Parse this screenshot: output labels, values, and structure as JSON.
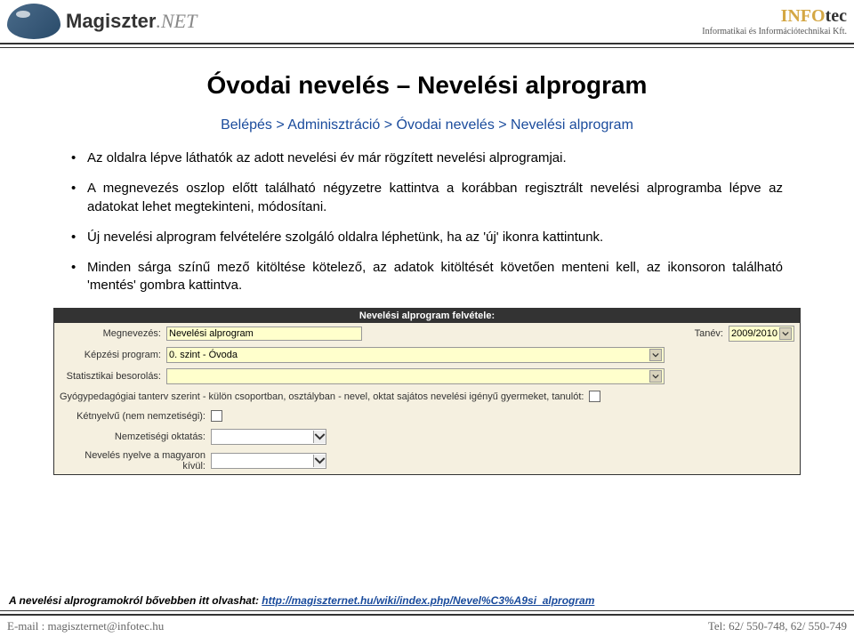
{
  "header": {
    "brand_main": "Magiszter",
    "brand_suffix": ".NET",
    "right_brand_a": "INFO",
    "right_brand_b": "tec",
    "right_sub": "Informatikai és Információtechnikai Kft."
  },
  "page": {
    "title": "Óvodai nevelés – Nevelési alprogram",
    "breadcrumb": "Belépés > Adminisztráció > Óvodai nevelés > Nevelési alprogram",
    "bullets": [
      "Az oldalra lépve láthatók az adott nevelési év már rögzített nevelési alprogramjai.",
      "A megnevezés oszlop előtt található négyzetre kattintva a korábban regisztrált nevelési alprogramba lépve az adatokat lehet megtekinteni, módosítani.",
      "Új nevelési alprogram felvételére szolgáló oldalra léphetünk, ha az 'új' ikonra kattintunk.",
      "Minden sárga színű mező kitöltése kötelező, az adatok kitöltését követően menteni kell, az ikonsoron található 'mentés' gombra kattintva."
    ]
  },
  "form": {
    "title": "Nevelési alprogram felvétele:",
    "rows": {
      "megnevezes_label": "Megnevezés:",
      "megnevezes_value": "Nevelési alprogram",
      "tanev_label": "Tanév:",
      "tanev_value": "2009/2010",
      "kepzesi_label": "Képzési program:",
      "kepzesi_value": "0. szint - Óvoda",
      "statisztikai_label": "Statisztikai besorolás:",
      "gyogyped_label": "Gyógypedagógiai tanterv szerint - külön csoportban, osztályban - nevel, oktat sajátos nevelési igényű gyermeket, tanulót:",
      "ketnyelvu_label": "Kétnyelvű (nem nemzetiségi):",
      "nemzetisegi_label": "Nemzetiségi oktatás:",
      "nyelve_label": "Nevelés nyelve a magyaron kívül:"
    }
  },
  "footer": {
    "more_label": "A nevelési alprogramokról bővebben itt olvashat: ",
    "more_url": "http://magiszternet.hu/wiki/index.php/Nevel%C3%A9si_alprogram",
    "email": "E-mail : magiszternet@infotec.hu",
    "tel": "Tel: 62/ 550-748, 62/ 550-749"
  }
}
